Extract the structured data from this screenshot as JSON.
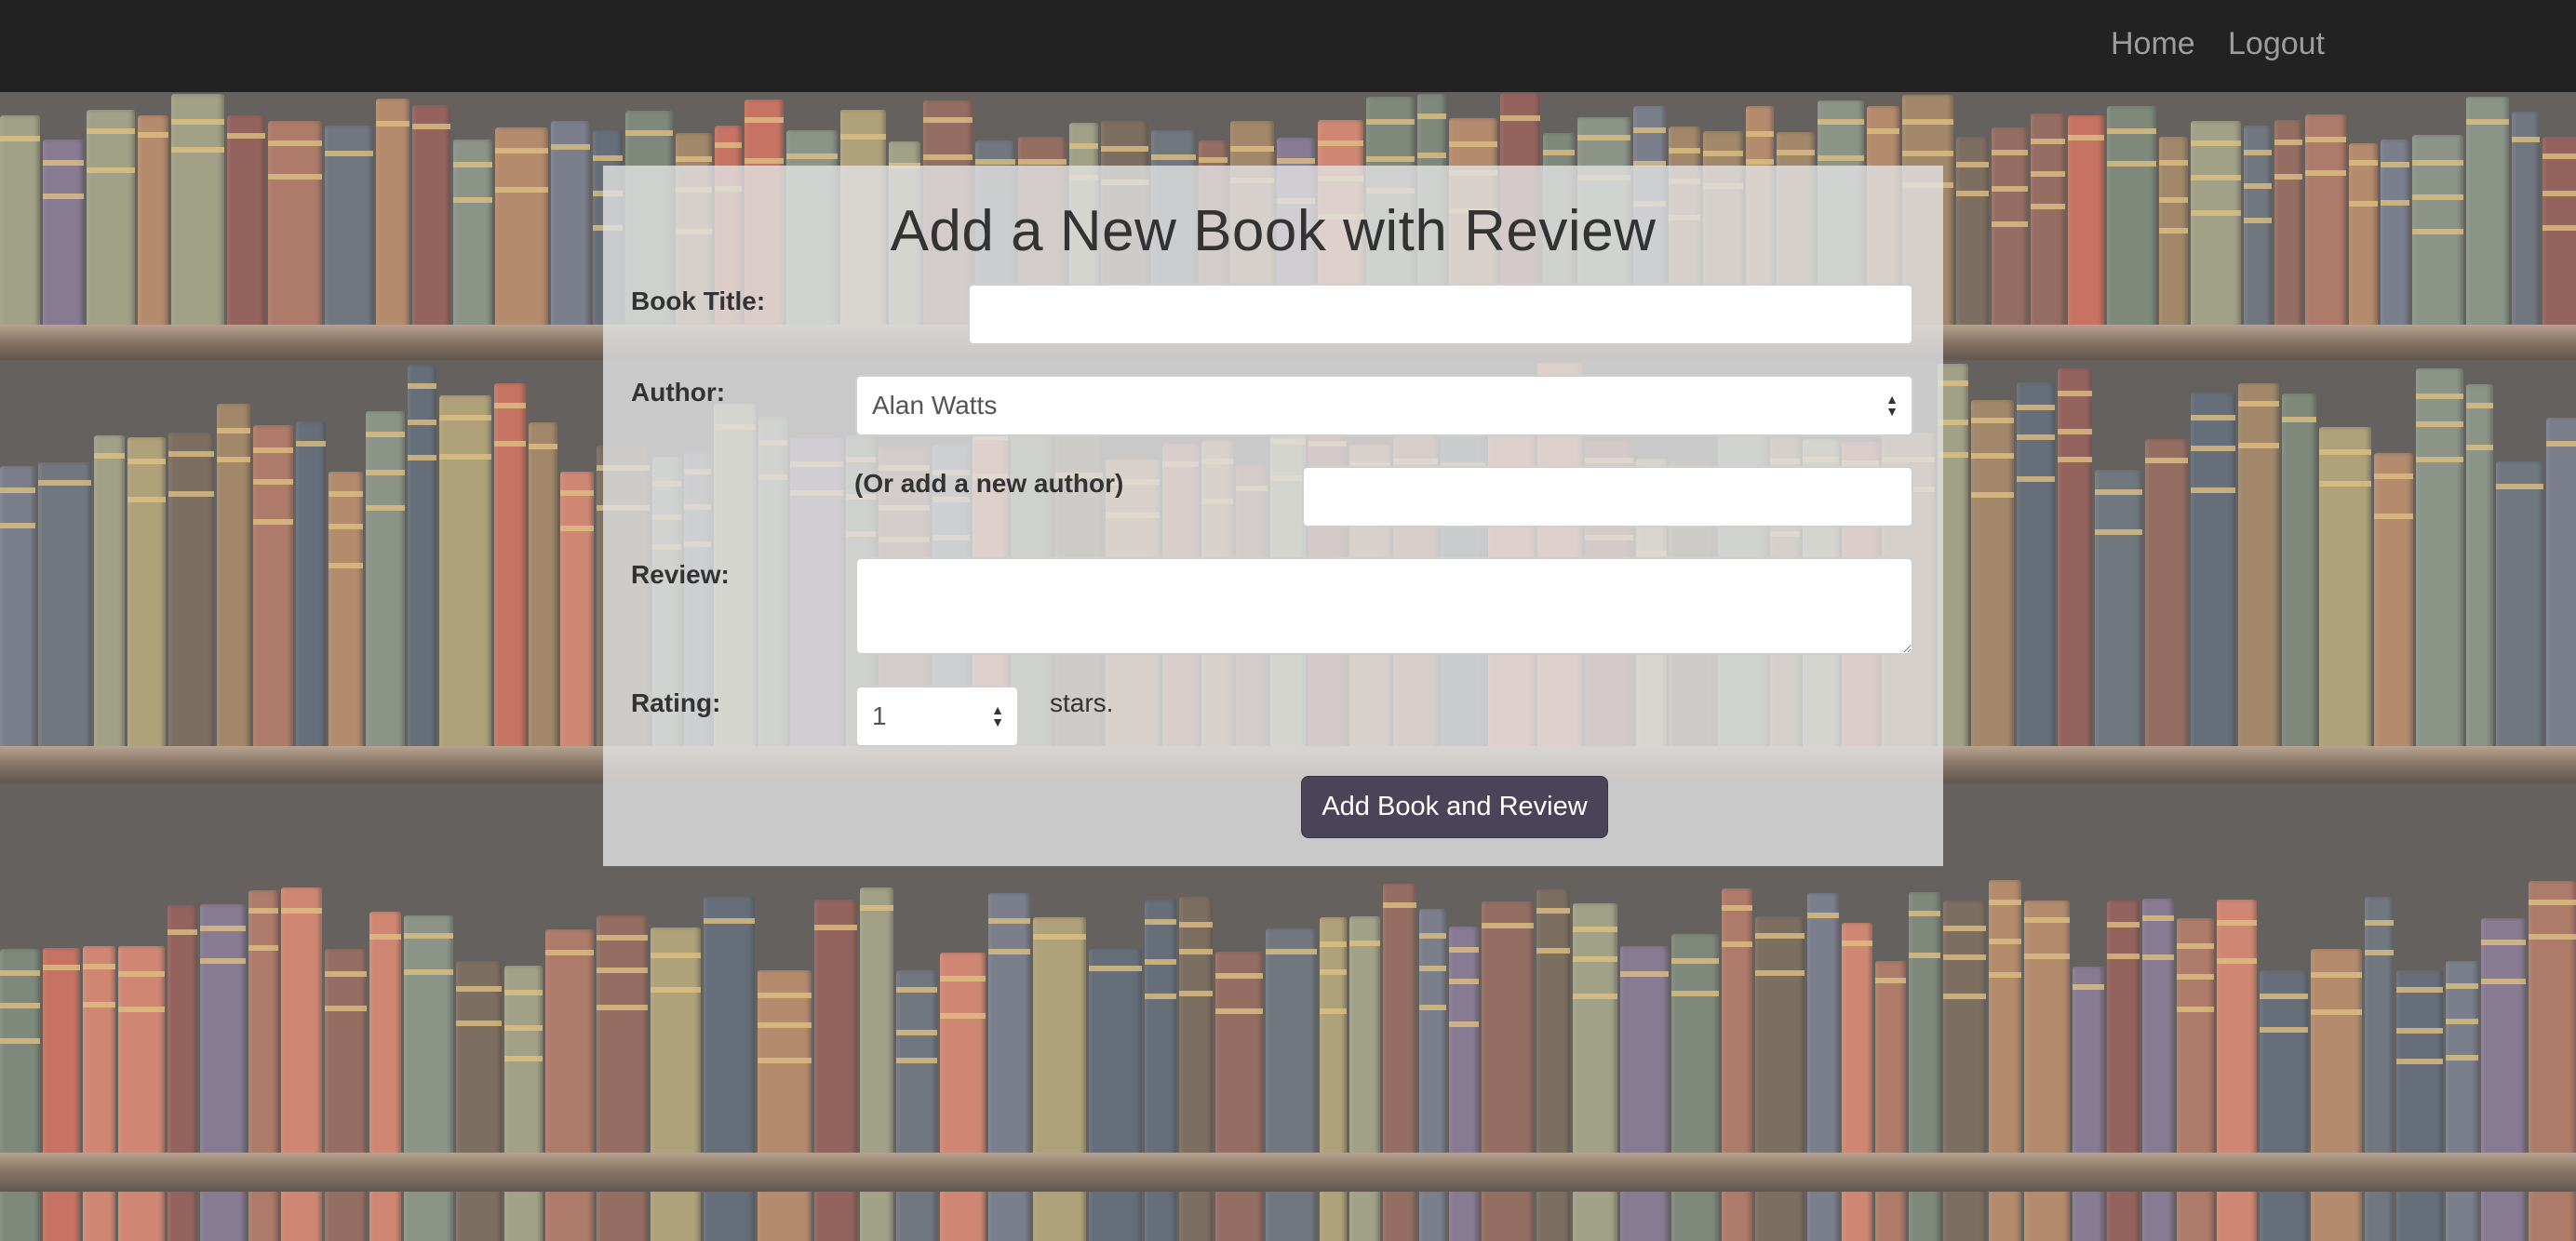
{
  "nav": {
    "home_label": "Home",
    "logout_label": "Logout"
  },
  "form": {
    "title": "Add a New Book with Review",
    "book_title_label": "Book Title:",
    "book_title_value": "",
    "author_label": "Author:",
    "author_selected": "Alan Watts",
    "new_author_label": "(Or add a new author)",
    "new_author_value": "",
    "review_label": "Review:",
    "review_value": "",
    "rating_label": "Rating:",
    "rating_selected": "1",
    "rating_suffix": "stars.",
    "submit_label": "Add Book and Review"
  },
  "colors": {
    "navbar": "#222222",
    "nav_link": "#9d9d9d",
    "button": "#4a4458"
  },
  "icons": {
    "select_arrows": "updown-arrows-icon"
  }
}
